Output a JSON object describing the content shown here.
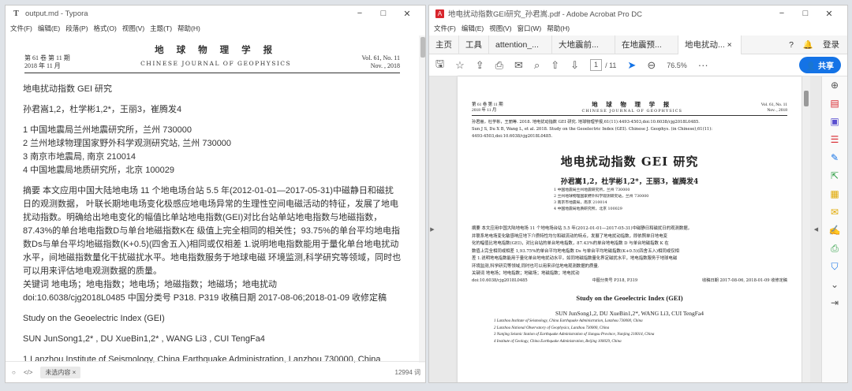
{
  "typora": {
    "title": "output.md - Typora",
    "logo": "T",
    "window_controls": [
      "−",
      "□",
      "✕"
    ],
    "menu": [
      "文件(F)",
      "编辑(E)",
      "段落(P)",
      "格式(O)",
      "视图(V)",
      "主题(T)",
      "帮助(H)"
    ],
    "journal": {
      "left1": "第 61 卷 第 11 期",
      "left2": "2018 年 11 月",
      "cn": "地 球 物 理 学 报",
      "en": "CHINESE JOURNAL OF GEOPHYSICS",
      "right1": "Vol. 61, No. 11",
      "right2": "Nov. , 2018"
    },
    "title_cn": "地电扰动指数 GEI 研究",
    "authors_cn": "孙君嵩1,2，杜学彬1,2*，王丽3，崔腾发4",
    "affiliations": [
      "1 中国地震局兰州地震研究所，兰州 730000",
      "2 兰州地球物理国家野外科学观测研究站, 兰州 730000",
      "3 南京市地震局, 南京 210014",
      "4 中国地震局地质研究所，北京 100029"
    ],
    "abstract": "摘要 本文应用中国大陆地电场 11 个地电场台站 5.5 年(2012-01-01—2017-05-31)中磁静日和磁扰日的观测数据， 叶联长期地电场变化极感应地电场异常的生理性空间电磁活动的特征，发展了地电扰动指数。明确给出地电变化的幅值比单站地电指数(GEI)对比台站单站地电指数与地磁指数，87.43%的单台地电指数D与单台地磁指数K在 级值上完全相同的相关性；93.75%的单台平均地电指数Ds与单台平均地磁指数(K+0.5)(四舍五入)相同或仅相差 1.说明地电指数能用于量化单台地电扰动水平，间地磁指数量化干扰磁扰水平。地电指数服务于地球电磁 环境监测,科学研究等领域，同时也可以用来评估地电观测数据的质量。",
    "keywords": "关键词 地电场；地电指数；地电场；地磁指数；地磁场；地电扰动",
    "doi": "doi:10.6038/cjg2018L0485 中国分类号 P318. P319 收稿日期 2017-08-06;2018-01-09 收修定稿",
    "title_en": "Study on the Geoelectric Index (GEI)",
    "authors_en": "SUN JunSong1,2* , DU XueBin1,2* , WANG Li3 , CUI TengFa4",
    "cutoff_line": "1 Lanzhou Institute of Seismology, China Earthquake Administration, Lanzhou 730000, China",
    "status_badge": "未选内容 ×",
    "word_count": "12994 词"
  },
  "acrobat": {
    "title": "地电扰动指数GEI研究_孙君嵩.pdf - Adobe Acrobat Pro DC",
    "menu": [
      "文件(F)",
      "编辑(E)",
      "视图(V)",
      "窗口(W)",
      "帮助(H)"
    ],
    "tabs": [
      "主页",
      "工具",
      "attention_...",
      "大地震前...",
      "在地震预...",
      "地电扰动... ×"
    ],
    "login": "登录",
    "page_current": "1",
    "page_total": "/ 11",
    "zoom": "76.5%",
    "share": "共享",
    "pdf": {
      "left1": "第 61 卷 第 11 期",
      "left2": "2018 年 11 月",
      "cn": "地 球 物 理 学 报",
      "en": "CHINESE JOURNAL OF GEOPHYSICS",
      "right1": "Vol. 61, No. 11",
      "right2": "Nov. , 2018",
      "cite_cn": "孙君嵩，杜学彬，王丽等. 2018. 地电扰动指数 GEI 研究. 地球物理学报,61(11):4493-4503,doi:10.6038/cjg2018L0485.",
      "cite_en": "Sun J S, Du X B, Wang L, et al. 2018. Study on the Geoelectric Index (GEI). Chinese J. Geophys. (in Chinese),61(11):",
      "cite_en2": "4493-4503,doi:10.6038/cjg2018L0485.",
      "title": "地电扰动指数 GEI 研究",
      "authors": "孙君嵩1,2，杜学彬1,2*，王丽3，崔腾发4",
      "affiliations": [
        "1 中国地震局兰州地震研究所，兰州 730000",
        "2 兰州地球物理国家野外科学观测研究站，兰州 730000",
        "3 南京市地震局，南京 210014",
        "4 中国地震局地质研究所，北京 100029"
      ],
      "abstract_lines": [
        "摘要 本文应用中国大陆地电场 11 个地电场台站 5.5 年(2012-01-01—2017-05-31)中磁静日和磁扰日的观测数据，",
        "并联系地电场变化敏感响应地下介质特性均匀和磁流动的特点，发展了地电扰动指数，即依照单日地电变",
        "化的幅值比地电指数(GEI)，对比台站的单台地电指数，87.43%的单台地电指数 D 与单台地磁指数 K 在",
        "数值上完全相同或相差 1,93.75%的单台平均地电指数 Ds 与单台平均地磁指数(K+0.5)(四舍五入)相同或仅相",
        "差 1.说明地电指数能用于量化单台地电扰动水平，如同地磁指数量化界定磁扰水平，地电指数服务于地球电磁",
        "环境监测,科学研究等领域,同时也可以用来评估地电观测数据的质量."
      ],
      "keywords": "关键词  地电场；地电指数；地磁场；地磁指数；地电扰动",
      "doi": "doi:10.6038/cjg2018L0485",
      "clc": "中图分类号  P318, P319",
      "received": "收稿日期 2017-08-06, 2018-01-09 收修定稿",
      "title_en": "Study on the Geoelectric Index (GEI)",
      "authors_en": "SUN JunSong1,2, DU XueBin1,2*, WANG Li3, CUI TengFa4",
      "affiliations_en": [
        "1 Lanzhou Institute of Seismology, China Earthquake Administration, Lanzhou 730000, China",
        "2 Lanzhou National Observatory of Geophysics, Lanzhou 730000, China",
        "3 Nanjing Seismic Station of Earthquake Administration of Jiangsu Province, Nanjing 210014, China",
        "4 Institute of Geology, China Earthquake Administration, Beijing 100029, China"
      ]
    }
  }
}
